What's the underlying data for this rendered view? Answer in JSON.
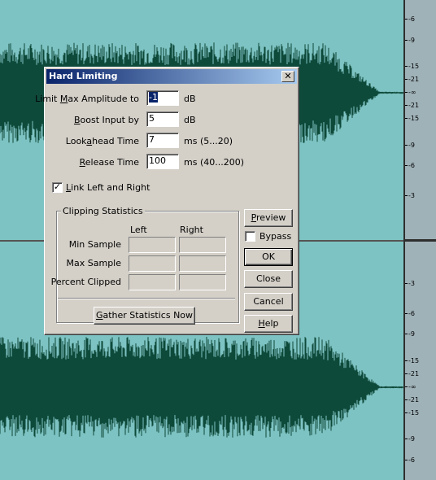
{
  "dialog": {
    "title": "Hard Limiting",
    "close_glyph": "✕",
    "fields": {
      "limit_max_amplitude": {
        "label_pre": "Limit ",
        "label_ul": "M",
        "label_post": "ax Amplitude to",
        "value": "-1",
        "unit": "dB"
      },
      "boost_input": {
        "label_pre": "",
        "label_ul": "B",
        "label_post": "oost Input by",
        "value": "5",
        "unit": "dB"
      },
      "lookahead_time": {
        "label_pre": "Look",
        "label_ul": "a",
        "label_post": "head Time",
        "value": "7",
        "unit": "ms (5...20)"
      },
      "release_time": {
        "label_pre": "",
        "label_ul": "R",
        "label_post": "elease Time",
        "value": "100",
        "unit": "ms (40...200)"
      }
    },
    "link_left_right": {
      "checked": true,
      "check_glyph": "✓",
      "label_ul": "L",
      "label_post": "ink Left and Right"
    },
    "clipping_statistics": {
      "title": "Clipping Statistics",
      "columns": [
        "Left",
        "Right"
      ],
      "rows": [
        "Min Sample",
        "Max Sample",
        "Percent Clipped"
      ],
      "gather_button": {
        "label_ul": "G",
        "label_post": "ather Statistics Now"
      }
    },
    "buttons": {
      "preview": {
        "label_ul": "P",
        "label_post": "review"
      },
      "bypass": {
        "label": "Bypass",
        "checked": false
      },
      "ok": {
        "label": "OK"
      },
      "close": {
        "label": "Close"
      },
      "cancel": {
        "label": "Cancel"
      },
      "help": {
        "label_ul": "H",
        "label_post": "elp"
      }
    }
  },
  "ruler": {
    "top_labels": [
      "-6",
      "-9",
      "-15",
      "-21",
      "-∞",
      "-21",
      "-15",
      "-9",
      "-6",
      "-3"
    ],
    "bottom_labels": [
      "-3",
      "-6",
      "-9",
      "-15",
      "-21",
      "-∞",
      "-21",
      "-15",
      "-9",
      "-6"
    ]
  },
  "colors": {
    "editor_background": "#7ec3c3",
    "waveform": "#0e4a3a",
    "dialog_face": "#d4d0c8",
    "titlebar_start": "#0a246a",
    "titlebar_end": "#a6caf0"
  }
}
